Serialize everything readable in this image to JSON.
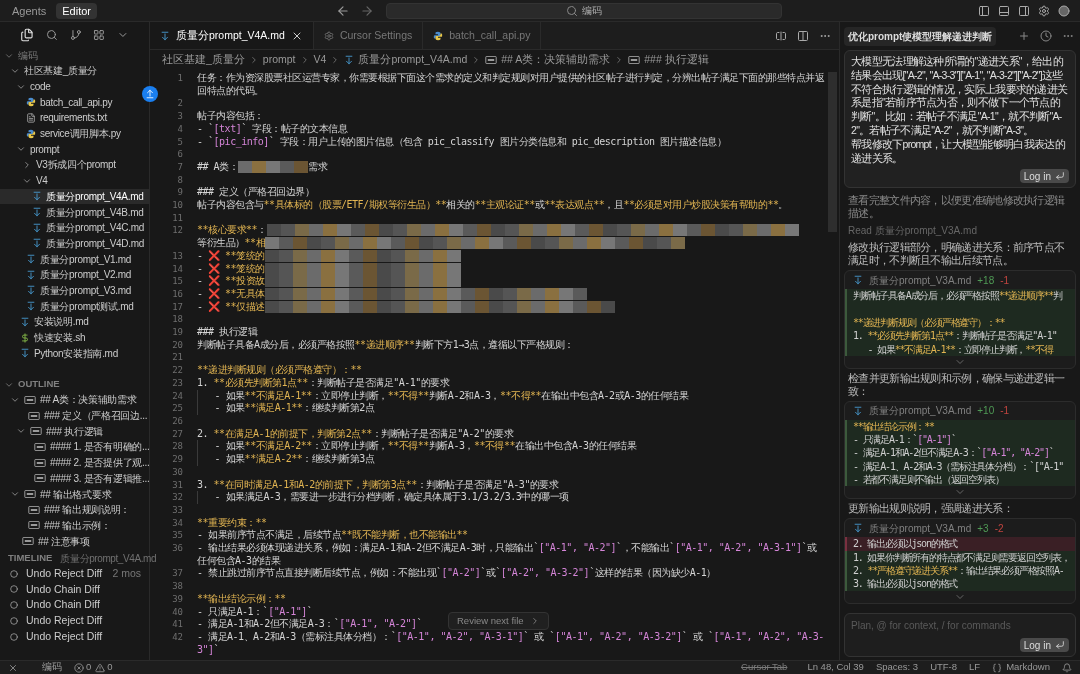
{
  "topbar": {
    "modes": [
      {
        "label": "Agents",
        "selected": false
      },
      {
        "label": "Editor",
        "selected": true
      }
    ],
    "search": {
      "value": "编码"
    }
  },
  "sidebar": {
    "section": "编码",
    "tree": [
      {
        "label": "社区基建_质量分",
        "expanded": true,
        "children": [
          {
            "label": "code",
            "expanded": true,
            "children": [
              {
                "label": "batch_call_api.py",
                "kind": "py",
                "selected": false
              },
              {
                "label": "requirements.txt",
                "kind": "txt",
                "selected": false
              },
              {
                "label": "service调用脚本.py",
                "kind": "py",
                "selected": false
              }
            ]
          },
          {
            "label": "prompt",
            "expanded": true,
            "children": [
              {
                "label": "V3拆成四个prompt",
                "expanded": false
              },
              {
                "label": "V4",
                "expanded": true,
                "children": [
                  {
                    "label": "质量分prompt_V4A.md",
                    "kind": "md",
                    "selected": true
                  },
                  {
                    "label": "质量分prompt_V4B.md",
                    "kind": "md",
                    "selected": false
                  },
                  {
                    "label": "质量分prompt_V4C.md",
                    "kind": "md",
                    "selected": false
                  },
                  {
                    "label": "质量分prompt_V4D.md",
                    "kind": "md",
                    "selected": false
                  }
                ]
              },
              {
                "label": "质量分prompt_V1.md",
                "kind": "md",
                "selected": false
              },
              {
                "label": "质量分prompt_V2.md",
                "kind": "md",
                "selected": false
              },
              {
                "label": "质量分prompt_V3.md",
                "kind": "md",
                "selected": false
              },
              {
                "label": "质量分prompt测试.md",
                "kind": "md",
                "selected": false
              }
            ]
          },
          {
            "label": "安装说明.md",
            "kind": "md",
            "selected": false
          },
          {
            "label": "快速安装.sh",
            "kind": "sh",
            "selected": false
          },
          {
            "label": "Python安装指南.md",
            "kind": "md",
            "selected": false
          }
        ]
      }
    ],
    "outline_title": "OUTLINE",
    "outline": [
      {
        "label": "## A类：决策辅助需求",
        "expanded": true,
        "children": [
          {
            "label": "### 定义（严格召回边..."
          },
          {
            "label": "### 执行逻辑",
            "expanded": true,
            "children": [
              {
                "label": "#### 1. 是否有明确的..."
              },
              {
                "label": "#### 2. 是否提供了观..."
              },
              {
                "label": "#### 3. 是否有逻辑推..."
              }
            ]
          }
        ]
      },
      {
        "label": "## 输出格式要求",
        "expanded": true,
        "children": [
          {
            "label": "### 输出规则说明："
          },
          {
            "label": "### 输出示例："
          }
        ]
      },
      {
        "label": "## 注意事项"
      }
    ],
    "timeline_title": "TIMELINE",
    "timeline_file": "质量分prompt_V4A.md",
    "timeline": [
      {
        "label": "Undo Reject Diff",
        "time": "2 mos"
      },
      {
        "label": "Undo Chain Diff"
      },
      {
        "label": "Undo Chain Diff"
      },
      {
        "label": "Undo Reject Diff"
      },
      {
        "label": "Undo Reject Diff"
      }
    ]
  },
  "tabs": [
    {
      "label": "质量分prompt_V4A.md",
      "kind": "md",
      "selected": true
    },
    {
      "label": "Cursor Settings",
      "kind": "settings",
      "selected": false
    },
    {
      "label": "batch_call_api.py",
      "kind": "py",
      "selected": false
    }
  ],
  "breadcrumb": [
    {
      "label": "社区基建_质量分"
    },
    {
      "label": "prompt"
    },
    {
      "label": "V4"
    },
    {
      "label": "质量分prompt_V4A.md",
      "kind": "md"
    },
    {
      "label": "## A类：决策辅助需求",
      "kind": "section"
    },
    {
      "label": "### 执行逻辑",
      "kind": "section"
    }
  ],
  "lines": [
    {
      "n": "1",
      "text": "任务：作为资深股票社区运营专家，你需要根据下面这个需求的定义和判定规则对用户提供的社区帖子进行判定，分辨出帖子满足下面的那些特点并返回特点的代码。"
    },
    {
      "n": "2"
    },
    {
      "n": "3",
      "text": "帖子内容包括："
    },
    {
      "n": "4",
      "text": "- `[txt]` 字段：帖子的文本信息"
    },
    {
      "n": "5",
      "text": "- `[pic_info]` 字段：用户上传的图片信息（包含 pic_classify 图片分类信息和 pic_description 图片描述信息）"
    },
    {
      "n": "6"
    },
    {
      "n": "7",
      "text": "## A类：",
      "redacted": true,
      "tail": "需求"
    },
    {
      "n": "8"
    },
    {
      "n": "9",
      "text": "### 定义（严格召回边界）"
    },
    {
      "n": "10",
      "text": "帖子内容包含与**具体标的（股票/ETF/期权等衍生品）**相关的**主观论证**或**表达观点**，且**必须是对用户炒股决策有帮助的**。"
    },
    {
      "n": "11"
    },
    {
      "n": "12",
      "text": "**核心要求**：",
      "redacted": true,
      "cont": "等衍生品）**相",
      "cont_redacted": true
    },
    {
      "n": "13",
      "text": "- ❌ **笼统的",
      "redacted": true
    },
    {
      "n": "14",
      "text": "- ❌ **笼统的",
      "redacted": true
    },
    {
      "n": "15",
      "text": "- ❌ **投资故",
      "redacted": true
    },
    {
      "n": "16",
      "text": "- ❌ **无具体",
      "redacted": true
    },
    {
      "n": "17",
      "text": "- ❌ **仅描述",
      "redacted": true
    },
    {
      "n": "18"
    },
    {
      "n": "19",
      "text": "### 执行逻辑"
    },
    {
      "n": "20",
      "text": "判断帖子具备A成分后，必须严格按照**递进顺序**判断下方1→3点，遵循以下严格规则："
    },
    {
      "n": "21"
    },
    {
      "n": "22",
      "text": "**递进判断规则（必须严格遵守）：**"
    },
    {
      "n": "23",
      "text": "1. **必须先判断第1点**：判断帖子是否满足\"A-1\"的要求"
    },
    {
      "n": "24",
      "text": "   - 如果**不满足A-1**：立即停止判断，**不得**判断A-2和A-3，**不得**在输出中包含A-2或A-3的任何结果",
      "guide": true
    },
    {
      "n": "25",
      "text": "   - 如果**满足A-1**：继续判断第2点",
      "guide": true
    },
    {
      "n": "26"
    },
    {
      "n": "27",
      "text": "2. **在满足A-1的前提下，判断第2点**：判断帖子是否满足\"A-2\"的要求"
    },
    {
      "n": "28",
      "text": "   - 如果**不满足A-2**：立即停止判断，**不得**判断A-3，**不得**在输出中包含A-3的任何结果",
      "guide": true
    },
    {
      "n": "29",
      "text": "   - 如果**满足A-2**：继续判断第3点",
      "guide": true
    },
    {
      "n": "30"
    },
    {
      "n": "31",
      "text": "3. **在同时满足A-1和A-2的前提下，判断第3点**：判断帖子是否满足\"A-3\"的要求"
    },
    {
      "n": "32",
      "text": "   - 如果满足A-3，需要进一步进行分档判断，确定具体属于3.1/3.2/3.3中的哪一项",
      "guide": true
    },
    {
      "n": "33"
    },
    {
      "n": "34",
      "text": "**重要约束：**"
    },
    {
      "n": "35",
      "text": "- 如果前序节点不满足，后续节点**既不能判断，也不能输出**"
    },
    {
      "n": "36",
      "text": "- 输出结果必须体现递进关系，例如：满足A-1和A-2但不满足A-3时，只能输出`[\"A-1\", \"A-2\"]`，不能输出`[\"A-1\", \"A-2\", \"A-3-1\"]`或任何包含A-3的结果"
    },
    {
      "n": "37",
      "text": "- 禁止跳过前序节点直接判断后续节点，例如：不能出现`[\"A-2\"]`或`[\"A-2\", \"A-3-2\"]`这样的结果（因为缺少A-1）"
    },
    {
      "n": "38"
    },
    {
      "n": "39",
      "text": "**输出结论示例：**"
    },
    {
      "n": "40",
      "text": "- 只满足A-1：`[\"A-1\"]`"
    },
    {
      "n": "41",
      "text": "- 满足A-1和A-2但不满足A-3：`[\"A-1\", \"A-2\"]`"
    },
    {
      "n": "42",
      "text": "- 满足A-1、A-2和A-3（需标注具体分档）：`[\"A-1\", \"A-2\", \"A-3-1\"]` 或 `[\"A-1\", \"A-2\", \"A-3-2\"]` 或 `[\"A-1\", \"A-2\", \"A-3-3\"]`"
    }
  ],
  "review_button": "Review next file",
  "chat": {
    "title": "优化prompt使模型理解递进判断",
    "user_message": [
      " 大模型无法理解这种所谓的\"递进关系\"，给出的结果会出现[\"A-2\", \"A-3-3\"][\"A-1\", \"A-3-2\"][\"A-2\"]这些不符合执行逻辑的情况，实际上我要求的递进关系是指\"若前序节点为否，则不做下一个节点的判断\"。比如：若帖子不满足\"A-1\"，就不判断\"A-2\"。若帖子不满足\"A-2\"，就不判断\"A-3\"。",
      "帮我修改下prompt，让大模型能够明白我表达的递进关系。"
    ],
    "login": "Log in",
    "items": [
      {
        "kind": "text",
        "text": "查看完整文件内容，以便更准确地修改执行逻辑描述。",
        "dim": true
      },
      {
        "kind": "read",
        "text": "Read 质量分prompt_V3A.md"
      },
      {
        "kind": "text",
        "text": "修改执行逻辑部分，明确递进关系：前序节点不满足时，不判断且不输出后续节点。",
        "dim": false
      },
      {
        "kind": "diff",
        "file": "质量分prompt_V3A.md",
        "added": "+18",
        "removed": "-1",
        "lines": [
          {
            "text": "判断帖子具备A成分后，必须严格按照**递进顺序**判",
            "kind": "added"
          },
          {
            "kind": "added"
          },
          {
            "text": "**递进判断规则（必须严格遵守）：**",
            "kind": "added"
          },
          {
            "text": "1. **必须先判断第1点**：判断帖子是否满足\"A-1\"",
            "kind": "added"
          },
          {
            "text": "   - 如果**不满足A-1**：立即停止判断，**不得",
            "kind": "added"
          }
        ]
      },
      {
        "kind": "text",
        "text": "检查并更新输出规则和示例，确保与递进逻辑一致：",
        "dim": false
      },
      {
        "kind": "diff",
        "file": "质量分prompt_V3A.md",
        "added": "+10",
        "removed": "-1",
        "lines": [
          {
            "text": "**输出结论示例：**",
            "kind": "added"
          },
          {
            "text": "- 只满足A-1：`[\"A-1\"]`",
            "kind": "added"
          },
          {
            "text": "- 满足A-1和A-2但不满足A-3：`[\"A-1\", \"A-2\"]`",
            "kind": "added"
          },
          {
            "text": "- 满足A-1、A-2和A-3（需标注具体分档）：`[\"A-1\"",
            "kind": "added"
          },
          {
            "text": "- 若都不满足则不输出（返回空列表）",
            "kind": "added"
          }
        ]
      },
      {
        "kind": "text",
        "text": "更新输出规则说明，强调递进关系：",
        "dim": false
      },
      {
        "kind": "diff",
        "file": "质量分prompt_V3A.md",
        "added": "+3",
        "removed": "-2",
        "lines": [
          {
            "text": "2. 输出必须以json的格式",
            "kind": "removed"
          },
          {
            "text": "1. 如果你判断所有的特点都不满足则需要返回空列表，",
            "kind": "added"
          },
          {
            "text": "2. **严格遵守递进关系**：输出结果必须严格按照A-",
            "kind": "added"
          },
          {
            "text": "3. 输出必须以json的格式",
            "kind": "added"
          }
        ]
      }
    ],
    "composer": {
      "placeholder": "Plan, @ for context, / for commands",
      "login": "Log in"
    }
  },
  "status": {
    "branch": "编码",
    "errors": "0",
    "warnings": "0",
    "right": [
      {
        "label": "Cursor Tab",
        "kind": "disabled"
      },
      {
        "label": "Ln 48, Col 39"
      },
      {
        "label": "Spaces: 3"
      },
      {
        "label": "UTF-8"
      },
      {
        "label": "LF"
      },
      {
        "label": "Markdown",
        "kind": "language"
      }
    ]
  }
}
